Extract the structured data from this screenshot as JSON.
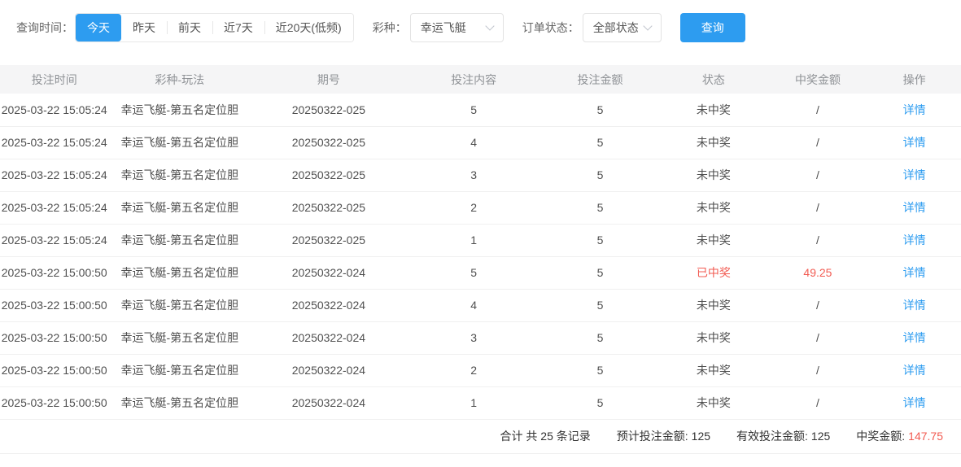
{
  "colors": {
    "accent": "#2d9cf0",
    "danger": "#f25b52"
  },
  "filters": {
    "time_label": "查询时间：",
    "time_options": [
      {
        "label": "今天",
        "active": true
      },
      {
        "label": "昨天",
        "active": false
      },
      {
        "label": "前天",
        "active": false
      },
      {
        "label": "近7天",
        "active": false
      },
      {
        "label": "近20天(低频)",
        "active": false
      }
    ],
    "lottery_label": "彩种：",
    "lottery_value": "幸运飞艇",
    "status_label": "订单状态：",
    "status_value": "全部状态",
    "query_button": "查询"
  },
  "table": {
    "columns": [
      "投注时间",
      "彩种-玩法",
      "期号",
      "投注内容",
      "投注金额",
      "状态",
      "中奖金额",
      "操作"
    ],
    "rows": [
      {
        "time": "2025-03-22 15:05:24",
        "play": "幸运飞艇-第五名定位胆",
        "issue": "20250322-025",
        "content": "5",
        "amount": "5",
        "status": "未中奖",
        "prize": "/",
        "action": "详情",
        "won": false
      },
      {
        "time": "2025-03-22 15:05:24",
        "play": "幸运飞艇-第五名定位胆",
        "issue": "20250322-025",
        "content": "4",
        "amount": "5",
        "status": "未中奖",
        "prize": "/",
        "action": "详情",
        "won": false
      },
      {
        "time": "2025-03-22 15:05:24",
        "play": "幸运飞艇-第五名定位胆",
        "issue": "20250322-025",
        "content": "3",
        "amount": "5",
        "status": "未中奖",
        "prize": "/",
        "action": "详情",
        "won": false
      },
      {
        "time": "2025-03-22 15:05:24",
        "play": "幸运飞艇-第五名定位胆",
        "issue": "20250322-025",
        "content": "2",
        "amount": "5",
        "status": "未中奖",
        "prize": "/",
        "action": "详情",
        "won": false
      },
      {
        "time": "2025-03-22 15:05:24",
        "play": "幸运飞艇-第五名定位胆",
        "issue": "20250322-025",
        "content": "1",
        "amount": "5",
        "status": "未中奖",
        "prize": "/",
        "action": "详情",
        "won": false
      },
      {
        "time": "2025-03-22 15:00:50",
        "play": "幸运飞艇-第五名定位胆",
        "issue": "20250322-024",
        "content": "5",
        "amount": "5",
        "status": "已中奖",
        "prize": "49.25",
        "action": "详情",
        "won": true
      },
      {
        "time": "2025-03-22 15:00:50",
        "play": "幸运飞艇-第五名定位胆",
        "issue": "20250322-024",
        "content": "4",
        "amount": "5",
        "status": "未中奖",
        "prize": "/",
        "action": "详情",
        "won": false
      },
      {
        "time": "2025-03-22 15:00:50",
        "play": "幸运飞艇-第五名定位胆",
        "issue": "20250322-024",
        "content": "3",
        "amount": "5",
        "status": "未中奖",
        "prize": "/",
        "action": "详情",
        "won": false
      },
      {
        "time": "2025-03-22 15:00:50",
        "play": "幸运飞艇-第五名定位胆",
        "issue": "20250322-024",
        "content": "2",
        "amount": "5",
        "status": "未中奖",
        "prize": "/",
        "action": "详情",
        "won": false
      },
      {
        "time": "2025-03-22 15:00:50",
        "play": "幸运飞艇-第五名定位胆",
        "issue": "20250322-024",
        "content": "1",
        "amount": "5",
        "status": "未中奖",
        "prize": "/",
        "action": "详情",
        "won": false
      }
    ]
  },
  "summary": {
    "total_text": "合计 共 25 条记录",
    "expected_label": "预计投注金额:",
    "expected_value": "125",
    "valid_label": "有效投注金额:",
    "valid_value": "125",
    "prize_label": "中奖金额:",
    "prize_value": "147.75"
  }
}
